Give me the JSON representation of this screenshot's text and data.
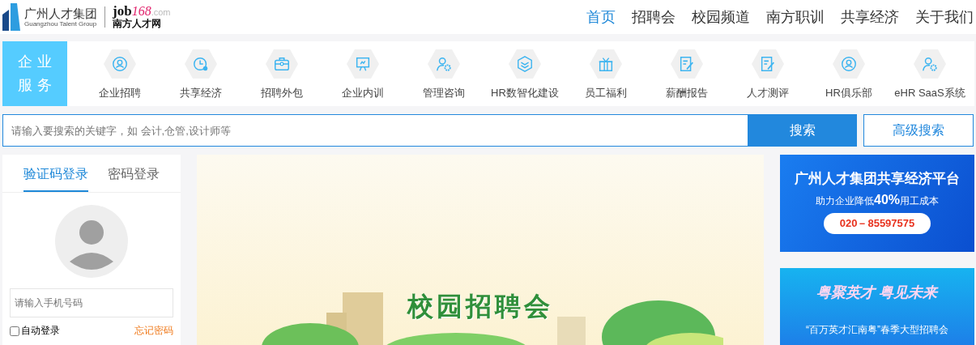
{
  "header": {
    "logo": {
      "name": "广州人才集团",
      "subtitle": "Guangzhou Talent Group",
      "site_brand": "job",
      "site_number": "168",
      "site_domain": ".com",
      "site_name": "南方人才网"
    },
    "nav": [
      {
        "label": "首页",
        "selected": true
      },
      {
        "label": "招聘会",
        "selected": false
      },
      {
        "label": "校园频道",
        "selected": false
      },
      {
        "label": "南方职训",
        "selected": false
      },
      {
        "label": "共享经济",
        "selected": false
      },
      {
        "label": "关于我们",
        "selected": false
      }
    ]
  },
  "services": {
    "title": "企业服务",
    "items": [
      {
        "label": "企业招聘"
      },
      {
        "label": "共享经济"
      },
      {
        "label": "招聘外包"
      },
      {
        "label": "企业内训"
      },
      {
        "label": "管理咨询"
      },
      {
        "label": "HR数智化建设"
      },
      {
        "label": "员工福利"
      },
      {
        "label": "薪酬报告"
      },
      {
        "label": "人才测评"
      },
      {
        "label": "HR俱乐部"
      },
      {
        "label": "eHR SaaS系统"
      }
    ]
  },
  "search": {
    "placeholder": "请输入要搜索的关键字，如 会计,仓管,设计师等",
    "button": "搜索",
    "advanced": "高级搜索"
  },
  "login": {
    "tabs": [
      {
        "label": "验证码登录",
        "selected": true
      },
      {
        "label": "密码登录",
        "selected": false
      }
    ],
    "phone_placeholder": "请输入手机号码",
    "auto_login": {
      "label": "自动登录",
      "checked": false
    },
    "forgot": "忘记密码"
  },
  "banner": {
    "title": "校园招聘会"
  },
  "ads": [
    {
      "title": "广州人才集团共享经济平台",
      "subtitle": "助力企业降低**40%**用工成本",
      "phone": "020－85597575"
    },
    {
      "title": "粤聚英才 粤见未来",
      "subtitle": "“百万英才汇南粤”春季大型招聘会"
    }
  ]
}
